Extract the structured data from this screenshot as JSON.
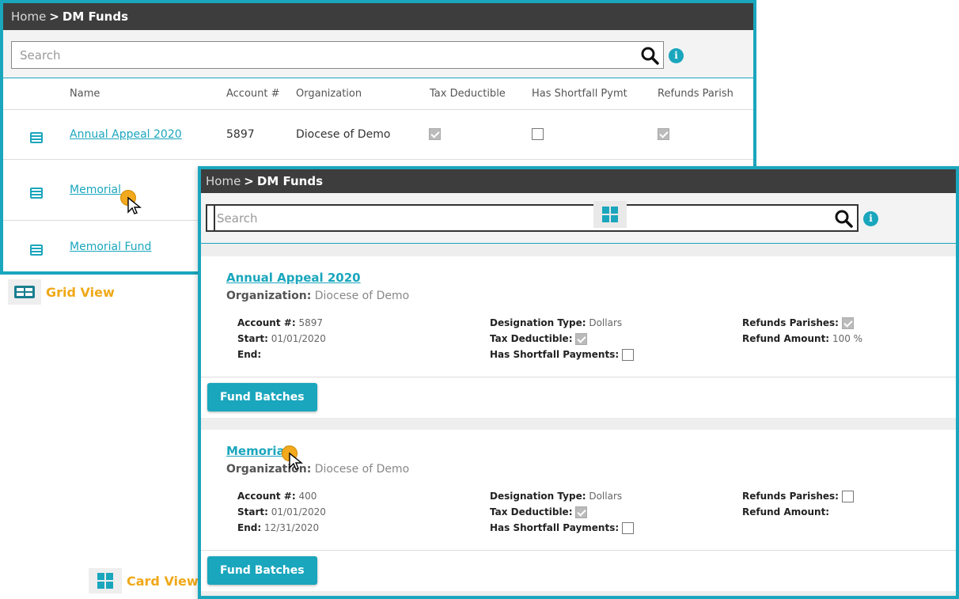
{
  "grid_view": {
    "breadcrumb": {
      "home": "Home",
      "sep": ">",
      "current": "DM Funds"
    },
    "search": {
      "placeholder": "Search"
    },
    "columns": [
      "Name",
      "Account #",
      "Organization",
      "Tax Deductible",
      "Has Shortfall Pymt",
      "Refunds Parish"
    ],
    "rows": [
      {
        "name": "Annual Appeal 2020",
        "account": "5897",
        "organization": "Diocese of Demo",
        "tax_deductible": true,
        "has_shortfall": false,
        "refunds_parish": true
      },
      {
        "name": "Memorial",
        "account": "",
        "organization": "",
        "tax_deductible": null,
        "has_shortfall": null,
        "refunds_parish": null
      },
      {
        "name": "Memorial Fund",
        "account": "",
        "organization": "",
        "tax_deductible": null,
        "has_shortfall": null,
        "refunds_parish": null
      }
    ]
  },
  "grid_view_label": "Grid View",
  "card_view_label": "Card View",
  "card_view": {
    "breadcrumb": {
      "home": "Home",
      "sep": ">",
      "current": "DM Funds"
    },
    "search": {
      "placeholder": "Search"
    },
    "cards": [
      {
        "title": "Annual Appeal 2020",
        "org_label": "Organization:",
        "org_value": "Diocese of Demo",
        "account_label": "Account #:",
        "account_value": "5897",
        "start_label": "Start:",
        "start_value": "01/01/2020",
        "end_label": "End:",
        "end_value": "",
        "designation_label": "Designation Type:",
        "designation_value": "Dollars",
        "tax_label": "Tax Deductible:",
        "tax_checked": true,
        "shortfall_label": "Has Shortfall Payments:",
        "shortfall_checked": false,
        "refunds_label": "Refunds Parishes:",
        "refunds_checked": true,
        "refund_amount_label": "Refund Amount:",
        "refund_amount_value": "100 %",
        "button": "Fund Batches"
      },
      {
        "title": "Memorial",
        "org_label": "Organization:",
        "org_value": "Diocese of Demo",
        "account_label": "Account #:",
        "account_value": "400",
        "start_label": "Start:",
        "start_value": "01/01/2020",
        "end_label": "End:",
        "end_value": "12/31/2020",
        "designation_label": "Designation Type:",
        "designation_value": "Dollars",
        "tax_label": "Tax Deductible:",
        "tax_checked": true,
        "shortfall_label": "Has Shortfall Payments:",
        "shortfall_checked": false,
        "refunds_label": "Refunds Parishes:",
        "refunds_checked": false,
        "refund_amount_label": "Refund Amount:",
        "refund_amount_value": "",
        "button": "Fund Batches"
      }
    ]
  },
  "colors": {
    "accent": "#1aa6bd",
    "topbar": "#3d3d3d",
    "label": "#f0a818"
  },
  "icons": [
    "list-icon",
    "search-icon",
    "info-icon",
    "grid-view-icon",
    "card-view-icon",
    "cursor-icon"
  ]
}
